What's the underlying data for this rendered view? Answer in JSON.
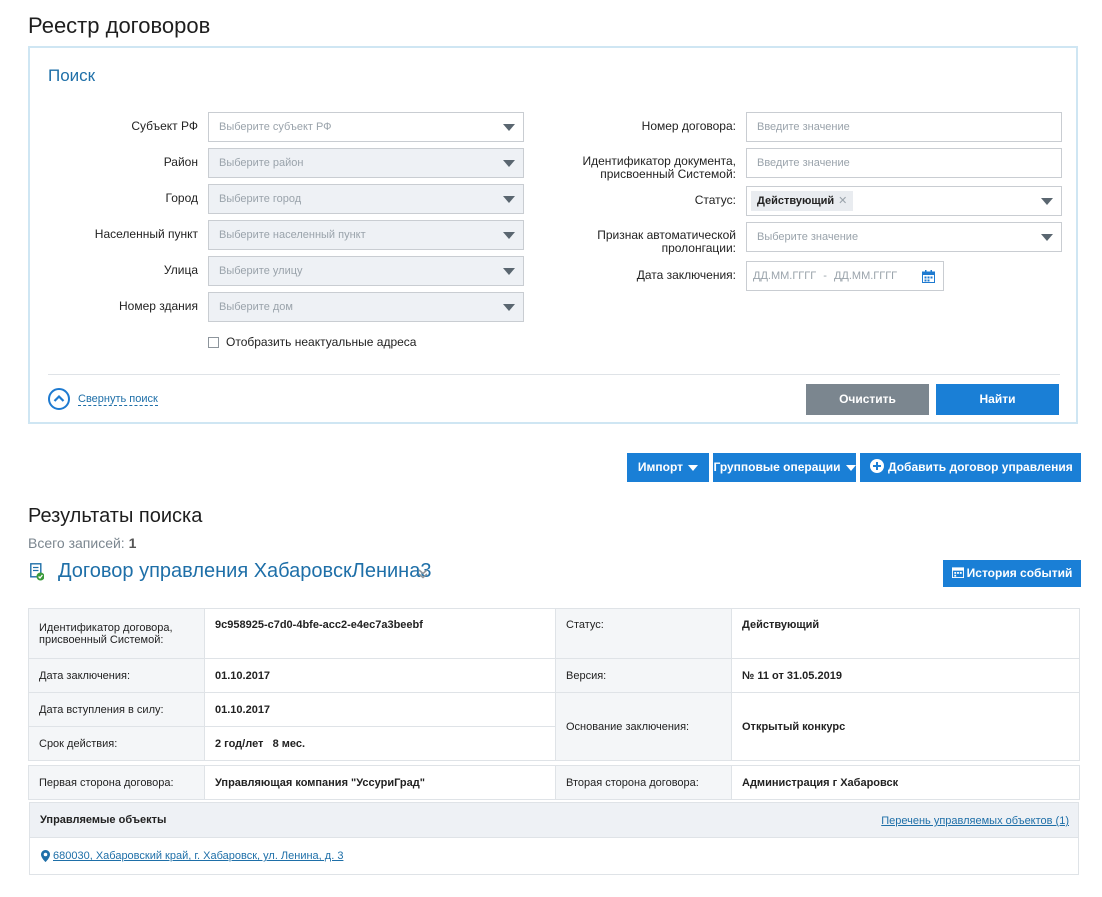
{
  "page_title": "Реестр договоров",
  "search": {
    "title": "Поиск",
    "fields_left": [
      {
        "label": "Субъект РФ",
        "placeholder": "Выберите субъект РФ"
      },
      {
        "label": "Район",
        "placeholder": "Выберите район"
      },
      {
        "label": "Город",
        "placeholder": "Выберите город"
      },
      {
        "label": "Населенный пункт",
        "placeholder": "Выберите населенный пункт"
      },
      {
        "label": "Улица",
        "placeholder": "Выберите улицу"
      },
      {
        "label": "Номер здания",
        "placeholder": "Выберите дом"
      }
    ],
    "show_inactive_label": "Отобразить неактуальные адреса",
    "contract_number": {
      "label": "Номер договора:",
      "placeholder": "Введите значение"
    },
    "doc_id": {
      "label_line1": "Идентификатор документа,",
      "label_line2": "присвоенный Системой:",
      "placeholder": "Введите значение"
    },
    "status": {
      "label": "Статус:",
      "value": "Действующий"
    },
    "auto_prolong": {
      "label_line1": "Признак автоматической",
      "label_line2": "пролонгации:",
      "placeholder": "Выберите значение"
    },
    "date": {
      "label": "Дата заключения:",
      "from_placeholder": "ДД.ММ.ГГГГ",
      "separator": "-",
      "to_placeholder": "ДД.ММ.ГГГГ"
    },
    "collapse_label": "Свернуть поиск",
    "clear_label": "Очистить",
    "find_label": "Найти"
  },
  "actions": {
    "import_label": "Импорт",
    "group_ops_label": "Групповые операции",
    "add_label": "Добавить договор управления"
  },
  "results": {
    "title": "Результаты поиска",
    "total_label": "Всего записей:",
    "total_value": "1"
  },
  "contract": {
    "title": "Договор управления ХабаровскЛенина3",
    "history_label": "История событий",
    "id_label_line1": "Идентификатор договора,",
    "id_label_line2": "присвоенный Системой:",
    "id_value": "9c958925-c7d0-4bfe-acc2-e4ec7a3beebf",
    "status_label": "Статус:",
    "status_value": "Действующий",
    "conclusion_date_label": "Дата заключения:",
    "conclusion_date_value": "01.10.2017",
    "version_label": "Версия:",
    "version_value": "№ 11 от 31.05.2019",
    "effective_date_label": "Дата вступления в силу:",
    "effective_date_value": "01.10.2017",
    "basis_label": "Основание заключения:",
    "basis_value": "Открытый конкурс",
    "term_label": "Срок действия:",
    "term_value": "2 год/лет   8 мес.",
    "first_party_label": "Первая сторона договора:",
    "first_party_value": "Управляющая компания \"УссуриГрад\"",
    "second_party_label": "Вторая сторона договора:",
    "second_party_value": "Администрация г Хабаровск",
    "managed_label": "Управляемые объекты",
    "managed_list_link": "Перечень управляемых объектов (1)",
    "address": "680030, Хабаровский край, г. Хабаровск, ул. Ленина, д. 3"
  }
}
